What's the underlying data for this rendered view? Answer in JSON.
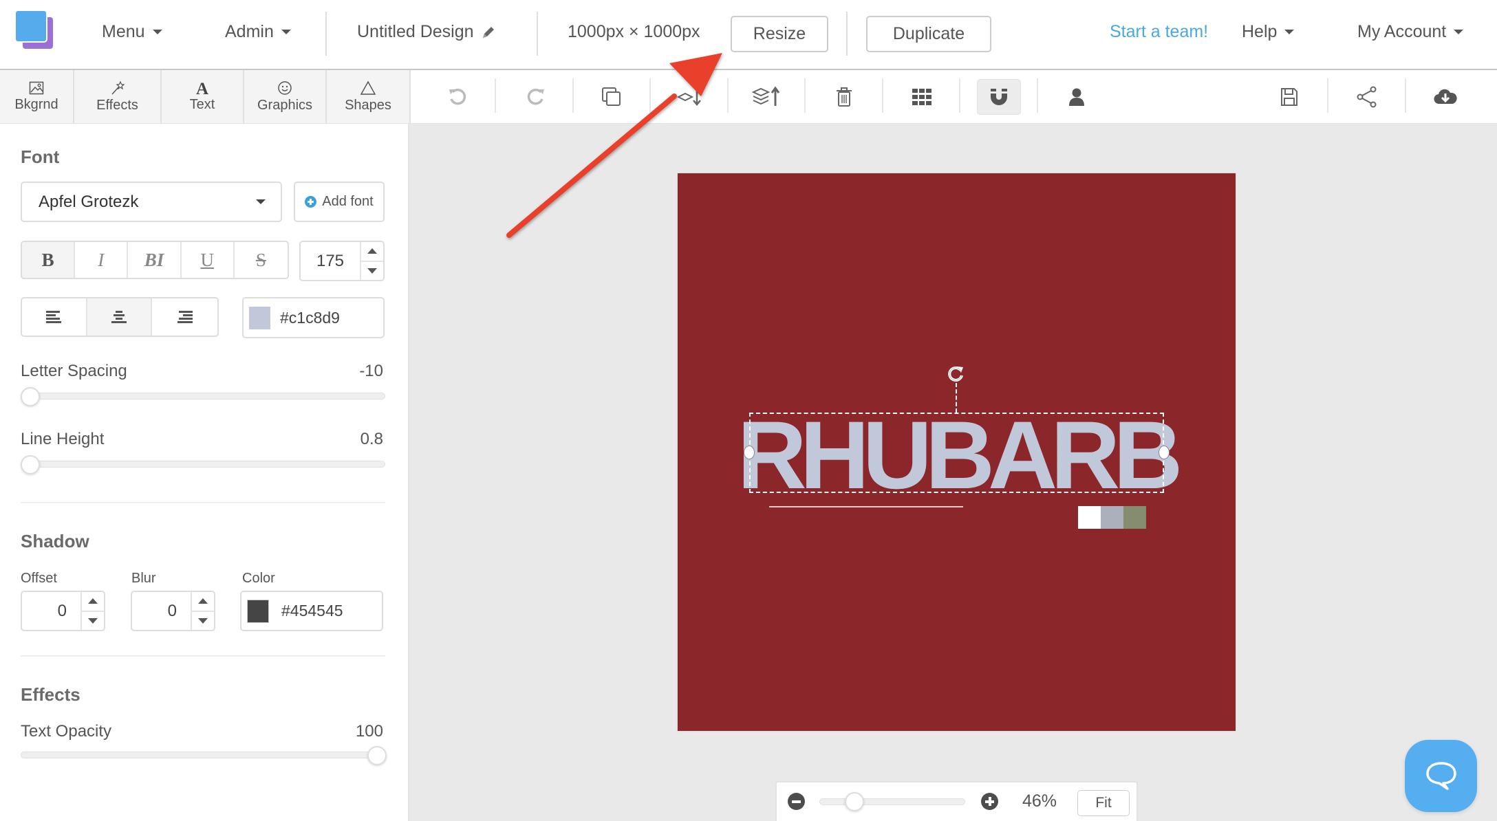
{
  "header": {
    "menu_label": "Menu",
    "admin_label": "Admin",
    "design_title": "Untitled Design",
    "dimensions": "1000px × 1000px",
    "resize_label": "Resize",
    "duplicate_label": "Duplicate",
    "start_team_label": "Start a team!",
    "help_label": "Help",
    "account_label": "My Account"
  },
  "tabs": [
    {
      "label": "Bkgrnd",
      "icon": "image-icon"
    },
    {
      "label": "Effects",
      "icon": "magic-wand-icon"
    },
    {
      "label": "Text",
      "icon": "text-icon"
    },
    {
      "label": "Graphics",
      "icon": "smiley-icon"
    },
    {
      "label": "Shapes",
      "icon": "triangle-icon"
    }
  ],
  "toolbar": {
    "icons": [
      "undo-icon",
      "redo-icon",
      "copy-icon",
      "send-backward-icon",
      "bring-forward-icon",
      "trash-icon",
      "grid-icon",
      "magnet-icon",
      "person-icon",
      "save-icon",
      "share-icon",
      "cloud-download-icon"
    ],
    "active": "magnet-icon"
  },
  "panel": {
    "font_section": "Font",
    "font_family": "Apfel Grotezk",
    "add_font_label": "Add font",
    "style_buttons": [
      "B",
      "I",
      "BI",
      "U",
      "S"
    ],
    "active_style": "B",
    "font_size": "175",
    "align_options": [
      "left",
      "center",
      "right"
    ],
    "active_align": "center",
    "text_color": "#c1c8d9",
    "letter_spacing_label": "Letter Spacing",
    "letter_spacing_value": "-10",
    "letter_spacing_fraction": 0.0,
    "line_height_label": "Line Height",
    "line_height_value": "0.8",
    "line_height_fraction": 0.0,
    "shadow_section": "Shadow",
    "offset_label": "Offset",
    "offset_value": "0",
    "blur_label": "Blur",
    "blur_value": "0",
    "color_label": "Color",
    "shadow_color": "#454545",
    "effects_section": "Effects",
    "text_opacity_label": "Text Opacity",
    "text_opacity_value": "100",
    "text_opacity_fraction": 1.0
  },
  "canvas": {
    "background_color": "#8b272b",
    "headline": "RHUBARB",
    "headline_color": "#c1c8d9",
    "palette": [
      "#ffffff",
      "#aab1bd",
      "#858c70"
    ]
  },
  "zoom": {
    "value": "46%",
    "fraction": 0.2,
    "fit_label": "Fit"
  },
  "annotation": {
    "arrow_color": "#e8412a",
    "points_to": "Resize"
  }
}
